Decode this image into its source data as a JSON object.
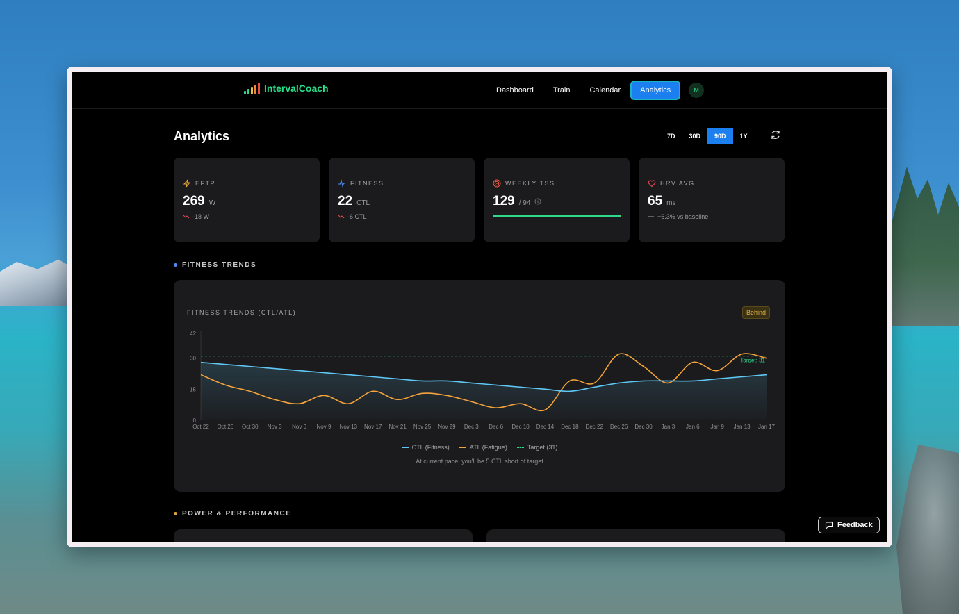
{
  "brand": {
    "name": "IntervalCoach"
  },
  "nav": {
    "links": [
      "Dashboard",
      "Train",
      "Calendar",
      "Analytics"
    ],
    "active": "Analytics",
    "avatar": "M"
  },
  "header": {
    "title": "Analytics",
    "ranges": [
      "7D",
      "30D",
      "90D",
      "1Y"
    ],
    "active_range": "90D"
  },
  "stats": [
    {
      "label": "EFTP",
      "value": "269",
      "unit": "W",
      "sub": "-18 W",
      "icon": "lightning-icon",
      "color": "#e0a23d"
    },
    {
      "label": "FITNESS",
      "value": "22",
      "unit": "CTL",
      "sub": "-6 CTL",
      "icon": "pulse-icon",
      "color": "#4d8cf5"
    },
    {
      "label": "WEEKLY TSS",
      "value": "129",
      "unit": "/ 94",
      "progress": 1.0,
      "icon": "target-icon",
      "color": "#f05a3c"
    },
    {
      "label": "HRV AVG",
      "value": "65",
      "unit": "ms",
      "sub": "+6.3% vs baseline",
      "icon": "heart-icon",
      "color": "#f04a5a"
    }
  ],
  "sections": {
    "fitness": "FITNESS TRENDS",
    "power": "POWER & PERFORMANCE"
  },
  "chart": {
    "badge": "Behind",
    "footnote": "At current pace, you'll be 5 CTL short of target"
  },
  "chart_data": {
    "type": "line",
    "title": "FITNESS TRENDS (CTL/ATL)",
    "x": [
      "Oct 22",
      "Oct 26",
      "Oct 30",
      "Nov 3",
      "Nov 6",
      "Nov 9",
      "Nov 13",
      "Nov 17",
      "Nov 21",
      "Nov 25",
      "Nov 29",
      "Dec 3",
      "Dec 6",
      "Dec 10",
      "Dec 14",
      "Dec 18",
      "Dec 22",
      "Dec 26",
      "Dec 30",
      "Jan 3",
      "Jan 6",
      "Jan 9",
      "Jan 13",
      "Jan 17"
    ],
    "ylim": [
      0,
      42
    ],
    "yticks": [
      0,
      15,
      30,
      42
    ],
    "grid": false,
    "legend": "bottom",
    "series": [
      {
        "name": "CTL (Fitness)",
        "color": "#5fc8f5",
        "values": [
          28,
          27,
          26,
          25,
          24,
          23,
          22,
          21,
          20,
          19,
          19,
          18,
          17,
          16,
          15,
          14,
          16,
          18,
          19,
          19,
          19,
          20,
          21,
          22
        ]
      },
      {
        "name": "ATL (Fatigue)",
        "color": "#f5a33a",
        "values": [
          22,
          17,
          14,
          10,
          8,
          12,
          8,
          14,
          10,
          13,
          12,
          9,
          6,
          8,
          5,
          19,
          18,
          32,
          26,
          18,
          28,
          24,
          32,
          30
        ]
      },
      {
        "name": "Target (31)",
        "color": "#2ed88a",
        "dashed": true,
        "values": [
          31,
          31,
          31,
          31,
          31,
          31,
          31,
          31,
          31,
          31,
          31,
          31,
          31,
          31,
          31,
          31,
          31,
          31,
          31,
          31,
          31,
          31,
          31,
          31
        ]
      }
    ],
    "annotations": [
      "Target: 31"
    ]
  },
  "feedback": {
    "label": "Feedback"
  }
}
